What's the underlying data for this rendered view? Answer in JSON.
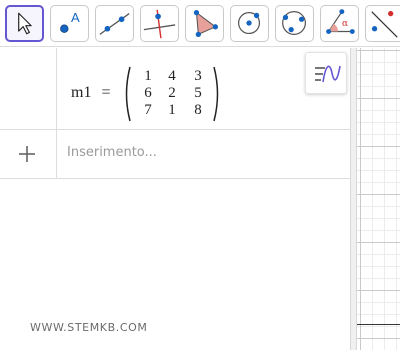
{
  "toolbar": {
    "tools": [
      {
        "icon": "move-arrow-icon",
        "active": true
      },
      {
        "icon": "point-icon",
        "label": "A"
      },
      {
        "icon": "line-icon"
      },
      {
        "icon": "perpendicular-line-icon"
      },
      {
        "icon": "polygon-icon"
      },
      {
        "icon": "circle-center-point-icon"
      },
      {
        "icon": "circle-three-points-icon"
      },
      {
        "icon": "angle-icon",
        "label": "α"
      },
      {
        "icon": "reflect-icon"
      }
    ]
  },
  "algebra": {
    "matrix_object": {
      "name": "m1",
      "equals": "=",
      "rows": [
        [
          "1",
          "4",
          "3"
        ],
        [
          "6",
          "2",
          "5"
        ],
        [
          "7",
          "1",
          "8"
        ]
      ]
    },
    "input": {
      "placeholder": "Inserimento..."
    },
    "style_bar_icon": "algebra-style-bar-icon"
  },
  "watermark": "WWW.STEMKB.COM",
  "colors": {
    "accent": "#6557d2",
    "point_blue": "#1565c0",
    "line_red": "#d32f2f",
    "polygon_fill": "#e8a09a"
  }
}
